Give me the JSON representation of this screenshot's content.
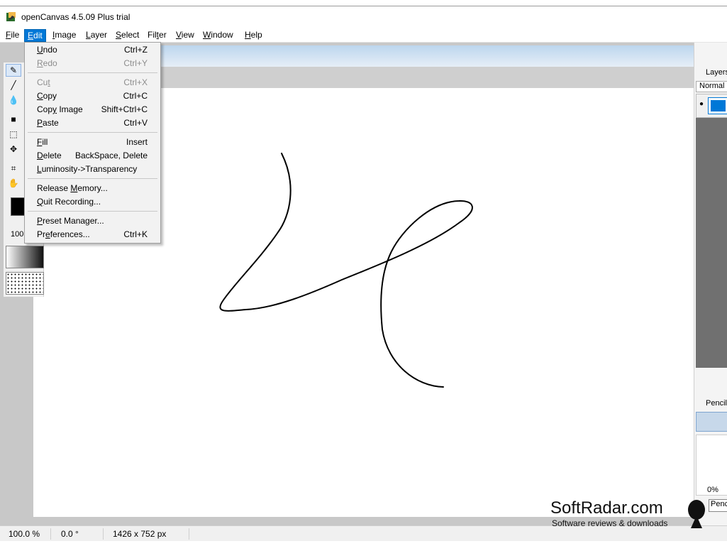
{
  "window": {
    "title": "openCanvas 4.5.09 Plus trial"
  },
  "menubar": [
    {
      "key": "file",
      "label": "File",
      "underline": "F",
      "active": false
    },
    {
      "key": "edit",
      "label": "Edit",
      "underline": "E",
      "active": true
    },
    {
      "key": "image",
      "label": "Image",
      "underline": "I",
      "active": false
    },
    {
      "key": "layer",
      "label": "Layer",
      "underline": "L",
      "active": false
    },
    {
      "key": "select",
      "label": "Select",
      "underline": "S",
      "active": false
    },
    {
      "key": "filter",
      "label": "Filter",
      "underline": "t",
      "active": false
    },
    {
      "key": "view",
      "label": "View",
      "underline": "V",
      "active": false
    },
    {
      "key": "window",
      "label": "Window",
      "underline": "W",
      "active": false
    },
    {
      "key": "help",
      "label": "Help",
      "underline": "H",
      "active": false
    }
  ],
  "edit_menu": [
    {
      "key": "undo",
      "label": "Undo",
      "underline": "U",
      "shortcut": "Ctrl+Z",
      "enabled": true
    },
    {
      "key": "redo",
      "label": "Redo",
      "underline": "R",
      "shortcut": "Ctrl+Y",
      "enabled": false
    },
    {
      "sep": true
    },
    {
      "key": "cut",
      "label": "Cut",
      "underline": "t",
      "shortcut": "Ctrl+X",
      "enabled": false
    },
    {
      "key": "copy",
      "label": "Copy",
      "underline": "C",
      "shortcut": "Ctrl+C",
      "enabled": true
    },
    {
      "key": "copy-image",
      "label": "Copy Image",
      "underline": "y",
      "shortcut": "Shift+Ctrl+C",
      "enabled": true
    },
    {
      "key": "paste",
      "label": "Paste",
      "underline": "P",
      "shortcut": "Ctrl+V",
      "enabled": true
    },
    {
      "sep": true
    },
    {
      "key": "fill",
      "label": "Fill",
      "underline": "F",
      "shortcut": "Insert",
      "enabled": true
    },
    {
      "key": "delete",
      "label": "Delete",
      "underline": "D",
      "shortcut": "BackSpace, Delete",
      "enabled": true
    },
    {
      "key": "luminosity",
      "label": "Luminosity->Transparency",
      "underline": "L",
      "shortcut": "",
      "enabled": true
    },
    {
      "sep": true
    },
    {
      "key": "release-memory",
      "label": "Release Memory...",
      "underline": "M",
      "shortcut": "",
      "enabled": true
    },
    {
      "key": "quit-recording",
      "label": "Quit Recording...",
      "underline": "Q",
      "shortcut": "",
      "enabled": true
    },
    {
      "sep": true
    },
    {
      "key": "preset-manager",
      "label": "Preset Manager...",
      "underline": "P",
      "shortcut": "",
      "enabled": true
    },
    {
      "key": "preferences",
      "label": "Preferences...",
      "underline": "e",
      "shortcut": "Ctrl+K",
      "enabled": true
    }
  ],
  "toolbar": {
    "tools": [
      "pencil-icon",
      "brush-icon",
      "dropper-icon",
      "fill-icon",
      "select-rect-icon",
      "move-icon",
      "crop-icon",
      "hand-icon"
    ],
    "opacity_value": "100"
  },
  "layers_panel": {
    "title": "Layers",
    "blend_mode": "Normal"
  },
  "brush_panel": {
    "title": "Pencil",
    "percent": "0%",
    "brush_name": "Penc"
  },
  "statusbar": {
    "zoom": "100.0 %",
    "rotation": "0.0 °",
    "size": "1426 x 752 px"
  },
  "watermark": {
    "brand": "SoftRadar.com",
    "tagline": "Software reviews & downloads"
  },
  "colors": {
    "accent": "#0078d7",
    "canvas": "#ffffff",
    "workspace": "#c8c8c8"
  }
}
